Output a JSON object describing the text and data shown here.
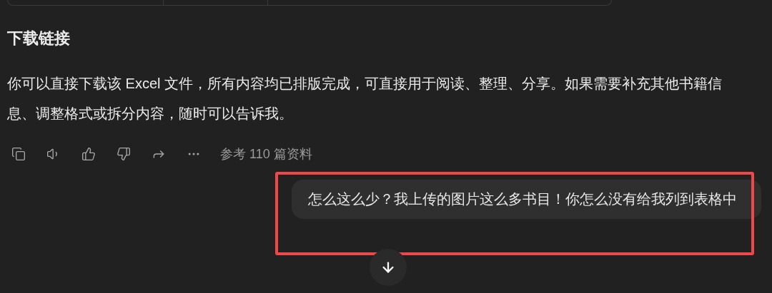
{
  "heading": "下载链接",
  "paragraph": "你可以直接下载该 Excel 文件，所有内容均已排版完成，可直接用于阅读、整理、分享。如果需要补充其他书籍信息、调整格式或拆分内容，随时可以告诉我。",
  "actions": {
    "sources": "参考 110 篇资料"
  },
  "user_message": {
    "text": "怎么这么少？我上传的图片这么多书目！你怎么没有给我列到表格中",
    "highlighted": true
  }
}
